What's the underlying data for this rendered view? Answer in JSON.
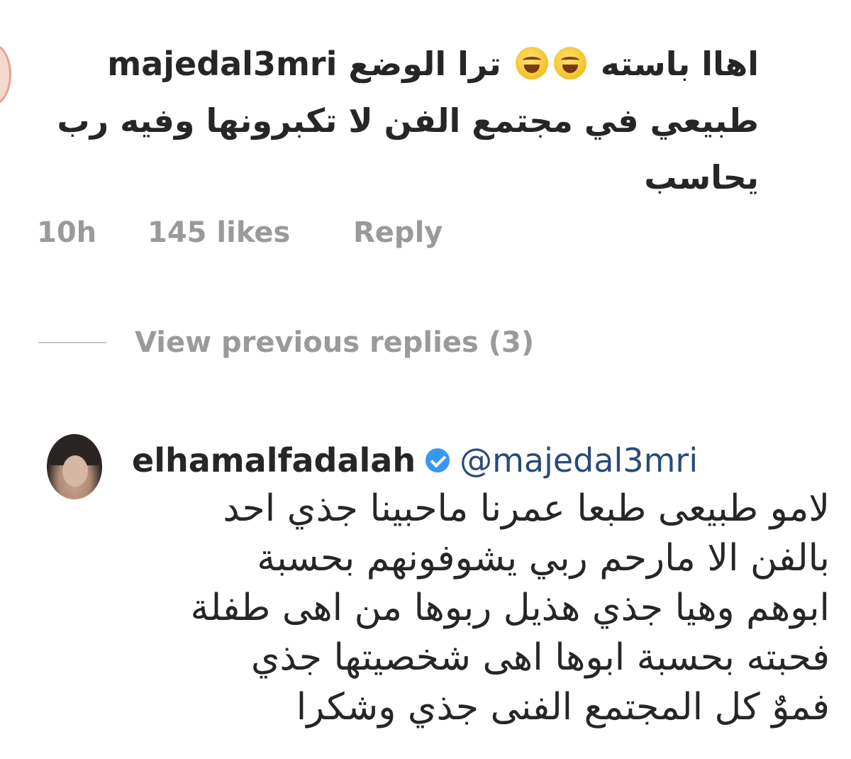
{
  "comment": {
    "username": "majedal3mri",
    "text_part1": "اهاا باسته",
    "emoji": "😂",
    "text_part2": "ترا الوضع",
    "line2": "طبيعي في مجتمع الفن لا تكبرونها وفيه رب",
    "line3": "يحاسب",
    "time": "10h",
    "likes": "145 likes",
    "reply_label": "Reply"
  },
  "view_replies": "View previous replies (3)",
  "reply": {
    "username": "elhamalfadalah",
    "mention": "@majedal3mri",
    "lines": [
      "لامو طبيعى طبعا عمرنا ماحبينا جذي احد",
      "بالفن الا مارحم ربي يشوفونهم بحسبة",
      "ابوهم وهيا جذي هذيل ربوها من اهى طفلة",
      "فحبته بحسبة ابوها اهى شخصيتها جذي",
      "فموٌ كل المجتمع الفنى جذي وشكرا"
    ]
  },
  "colors": {
    "text": "#262626",
    "meta": "#9a9a9a",
    "verified": "#3897f0",
    "mention": "#2a4a78"
  }
}
